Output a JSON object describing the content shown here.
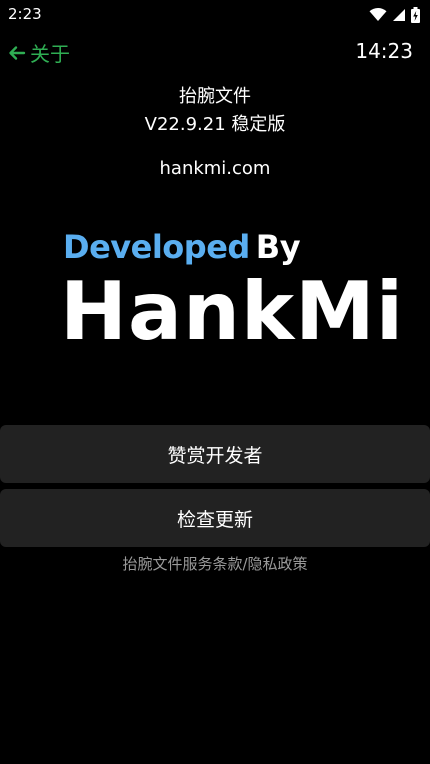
{
  "status_bar": {
    "time": "2:23",
    "icons": [
      "wifi-icon",
      "signal-icon",
      "battery-icon"
    ]
  },
  "header": {
    "back_label": "关于",
    "clock": "14:23",
    "accent_color": "#2fae53"
  },
  "app_info": {
    "name": "抬腕文件",
    "version": "V22.9.21 稳定版",
    "website": "hankmi.com"
  },
  "developer_logo": {
    "developed": "Developed",
    "by": "By",
    "name": "HankMi",
    "developed_color": "#5aaef0"
  },
  "actions": {
    "sponsor_label": "赞赏开发者",
    "update_label": "检查更新"
  },
  "footer": {
    "terms_link": "抬腕文件服务条款/隐私政策"
  }
}
